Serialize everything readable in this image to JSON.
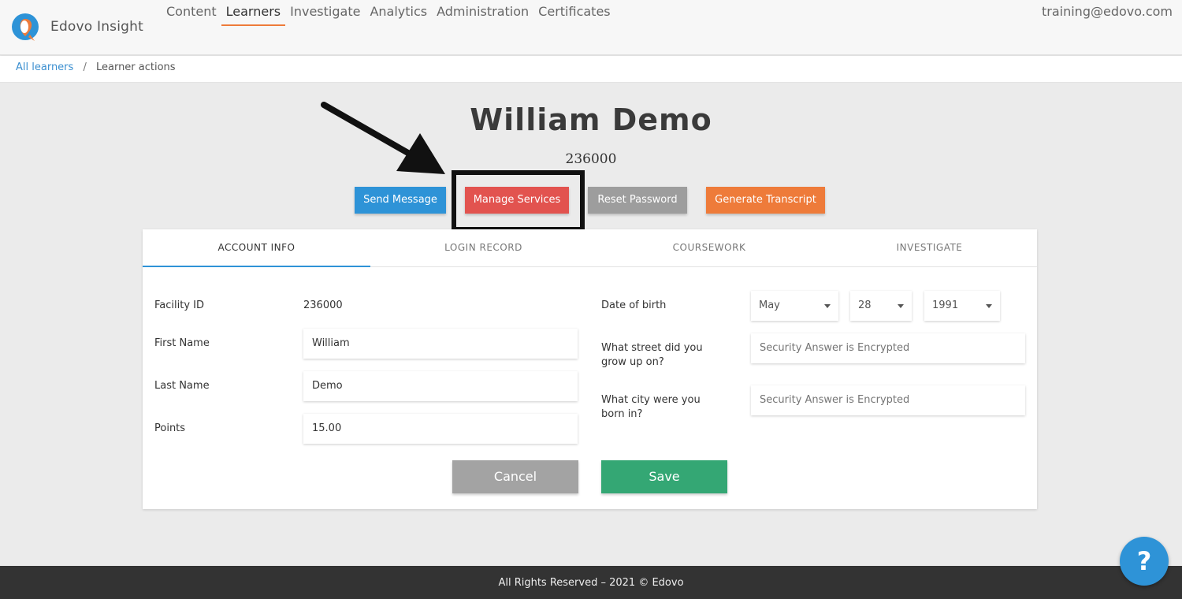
{
  "app": {
    "brand": "Edovo Insight",
    "user_email": "training@edovo.com"
  },
  "nav": {
    "items": [
      {
        "label": "Content"
      },
      {
        "label": "Learners"
      },
      {
        "label": "Investigate"
      },
      {
        "label": "Analytics"
      },
      {
        "label": "Administration"
      },
      {
        "label": "Certificates"
      }
    ],
    "active": "Learners"
  },
  "breadcrumb": {
    "link": "All learners",
    "separator": "/",
    "current": "Learner actions"
  },
  "learner": {
    "name": "William Demo",
    "id": "236000"
  },
  "actions": {
    "send_message": "Send Message",
    "manage_services": "Manage Services",
    "reset_password": "Reset Password",
    "generate_transcript": "Generate Transcript"
  },
  "tabs": [
    {
      "label": "ACCOUNT INFO"
    },
    {
      "label": "LOGIN RECORD"
    },
    {
      "label": "COURSEWORK"
    },
    {
      "label": "INVESTIGATE"
    }
  ],
  "form": {
    "facility_id_label": "Facility ID",
    "facility_id_value": "236000",
    "first_name_label": "First Name",
    "first_name_value": "William",
    "last_name_label": "Last Name",
    "last_name_value": "Demo",
    "points_label": "Points",
    "points_value": "15.00",
    "dob_label": "Date of birth",
    "dob_month": "May",
    "dob_day": "28",
    "dob_year": "1991",
    "q1_label": "What street did you grow up on?",
    "q1_placeholder": "Security Answer is Encrypted",
    "q2_label": "What city were you born in?",
    "q2_placeholder": "Security Answer is Encrypted",
    "cancel": "Cancel",
    "save": "Save"
  },
  "footer": {
    "text": "All Rights Reserved – 2021 © Edovo"
  },
  "help": {
    "label": "?"
  },
  "colors": {
    "accent_orange": "#ee7b3a",
    "blue": "#2e93d7",
    "red": "#e2534f",
    "gray": "#9d9d9d",
    "green": "#34a774"
  }
}
